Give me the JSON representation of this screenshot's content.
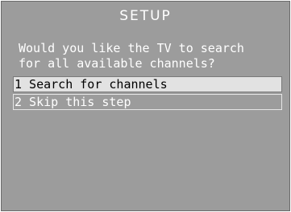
{
  "title": "SETUP",
  "prompt": {
    "line1": "Would you like the TV to search",
    "line2": "for all available channels?"
  },
  "options": [
    {
      "label": "1 Search for channels",
      "selected": true
    },
    {
      "label": "2 Skip this step",
      "selected": false
    }
  ],
  "colors": {
    "background": "#9c9c9c",
    "text": "#ffffff",
    "selected_bg": "#e2e2e2",
    "selected_text": "#000000"
  }
}
